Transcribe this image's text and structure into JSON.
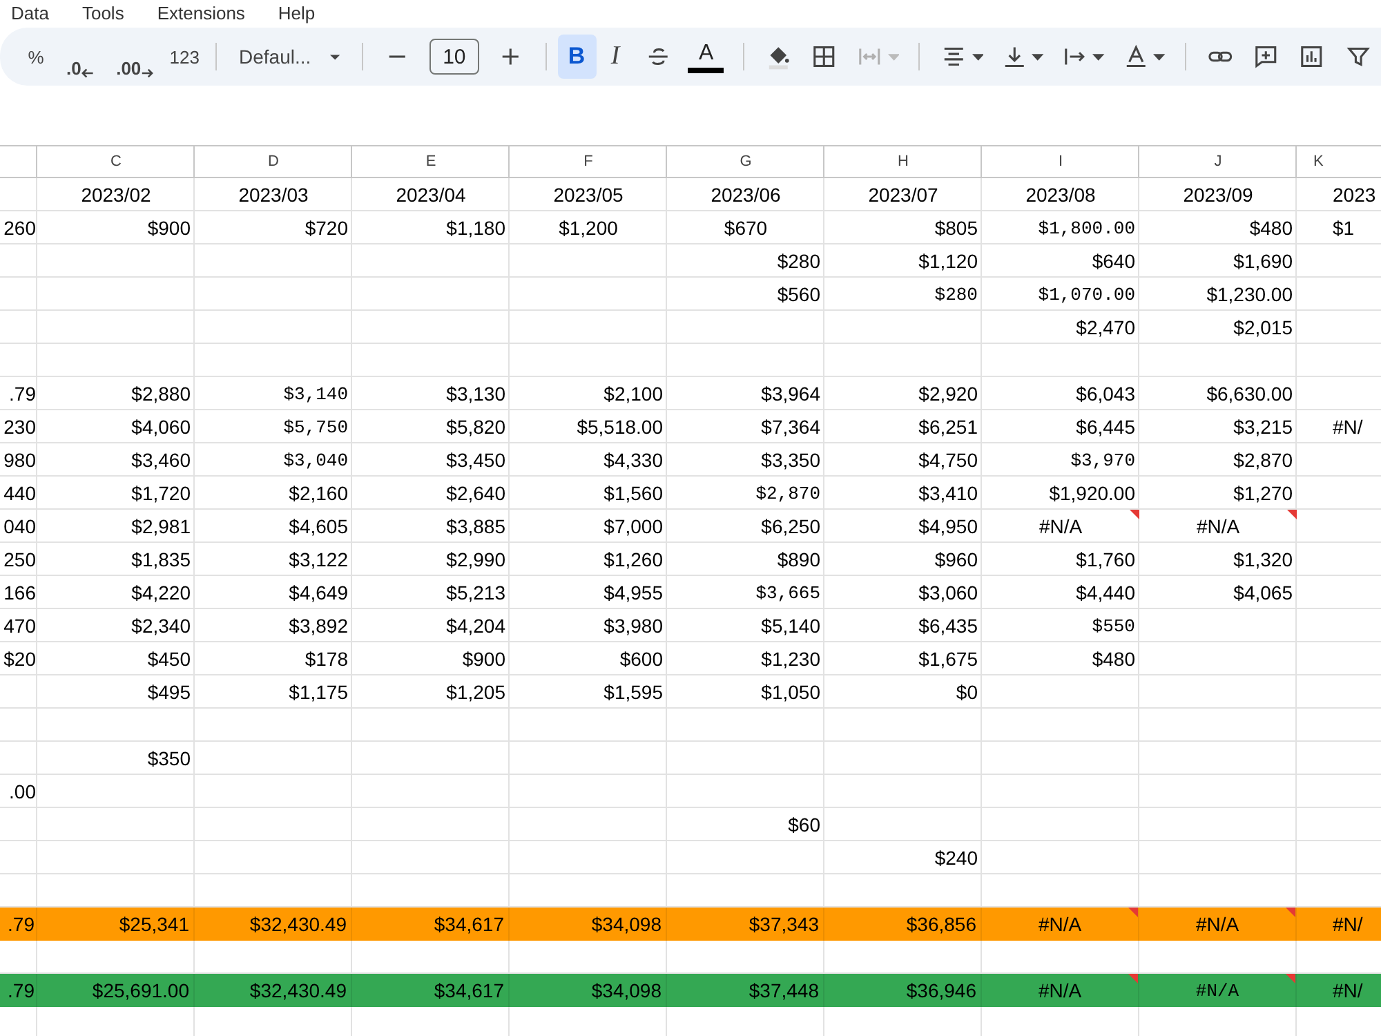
{
  "menu": [
    "Data",
    "Tools",
    "Extensions",
    "Help"
  ],
  "toolbar": {
    "percent": "%",
    "decrease_decimals": ".0",
    "increase_decimals": ".00",
    "number_format": "123",
    "font": "Defaul...",
    "font_size": "10",
    "bold": {
      "label": "B",
      "selected": true
    },
    "italic": "I",
    "text_color": "A",
    "merge_disabled": true
  },
  "columns": [
    "C",
    "D",
    "E",
    "F",
    "G",
    "H",
    "I",
    "J",
    "K"
  ],
  "rows": [
    {
      "cells": [
        null,
        {
          "text": "2023/02",
          "centered": true
        },
        {
          "text": "2023/03",
          "centered": true
        },
        {
          "text": "2023/04",
          "centered": true
        },
        {
          "text": "2023/05",
          "centered": true
        },
        {
          "text": "2023/06",
          "centered": true
        },
        {
          "text": "2023/07",
          "centered": true
        },
        {
          "text": "2023/08",
          "centered": true
        },
        {
          "text": "2023/09",
          "centered": true
        },
        "2023"
      ]
    },
    {
      "cells": [
        "260",
        "$900",
        "$720",
        "$1,180",
        {
          "text": "$1,200",
          "centered": true
        },
        {
          "text": "$670",
          "centered": true
        },
        "$805",
        {
          "text": "$1,800.00",
          "mono": true
        },
        "$480",
        "$1"
      ]
    },
    {
      "cells": [
        null,
        null,
        null,
        null,
        null,
        "$280",
        "$1,120",
        "$640",
        "$1,690",
        null
      ]
    },
    {
      "cells": [
        null,
        null,
        null,
        null,
        null,
        "$560",
        {
          "text": "$280",
          "mono": true
        },
        {
          "text": "$1,070.00",
          "mono": true
        },
        "$1,230.00",
        null
      ]
    },
    {
      "cells": [
        null,
        null,
        null,
        null,
        null,
        null,
        null,
        "$2,470",
        "$2,015",
        null
      ]
    },
    {
      "cells": [
        null,
        null,
        null,
        null,
        null,
        null,
        null,
        null,
        null,
        null
      ]
    },
    {
      "cells": [
        ".79",
        "$2,880",
        {
          "text": "$3,140",
          "mono": true
        },
        "$3,130",
        "$2,100",
        "$3,964",
        "$2,920",
        "$6,043",
        "$6,630.00",
        null
      ]
    },
    {
      "cells": [
        "230",
        "$4,060",
        {
          "text": "$5,750",
          "mono": true
        },
        "$5,820",
        "$5,518.00",
        "$7,364",
        "$6,251",
        "$6,445",
        "$3,215",
        "#N/"
      ]
    },
    {
      "cells": [
        "980",
        "$3,460",
        {
          "text": "$3,040",
          "mono": true
        },
        "$3,450",
        "$4,330",
        "$3,350",
        "$4,750",
        {
          "text": "$3,970",
          "mono": true
        },
        "$2,870",
        null
      ]
    },
    {
      "cells": [
        "440",
        "$1,720",
        "$2,160",
        "$2,640",
        "$1,560",
        {
          "text": "$2,870",
          "mono": true
        },
        "$3,410",
        "$1,920.00",
        "$1,270",
        null
      ]
    },
    {
      "cells": [
        "040",
        "$2,981",
        "$4,605",
        "$3,885",
        "$7,000",
        "$6,250",
        "$4,950",
        {
          "text": "#N/A",
          "centered": true,
          "flagged": true
        },
        {
          "text": "#N/A",
          "centered": true,
          "flagged": true
        },
        null
      ]
    },
    {
      "cells": [
        "250",
        "$1,835",
        "$3,122",
        "$2,990",
        "$1,260",
        "$890",
        "$960",
        "$1,760",
        "$1,320",
        null
      ]
    },
    {
      "cells": [
        "166",
        "$4,220",
        "$4,649",
        "$5,213",
        "$4,955",
        {
          "text": "$3,665",
          "mono": true
        },
        "$3,060",
        "$4,440",
        "$4,065",
        null
      ]
    },
    {
      "cells": [
        "470",
        "$2,340",
        "$3,892",
        "$4,204",
        "$3,980",
        "$5,140",
        "$6,435",
        {
          "text": "$550",
          "mono": true
        },
        null,
        null
      ]
    },
    {
      "cells": [
        "$20",
        "$450",
        "$178",
        "$900",
        "$600",
        "$1,230",
        "$1,675",
        "$480",
        null,
        null
      ]
    },
    {
      "cells": [
        null,
        "$495",
        "$1,175",
        "$1,205",
        "$1,595",
        "$1,050",
        "$0",
        null,
        null,
        null
      ]
    },
    {
      "cells": [
        null,
        null,
        null,
        null,
        null,
        null,
        null,
        null,
        null,
        null
      ]
    },
    {
      "cells": [
        null,
        "$350",
        null,
        null,
        null,
        null,
        null,
        null,
        null,
        null
      ]
    },
    {
      "cells": [
        ".00",
        null,
        null,
        null,
        null,
        null,
        null,
        null,
        null,
        null
      ]
    },
    {
      "cells": [
        null,
        null,
        null,
        null,
        null,
        "$60",
        null,
        null,
        null,
        null
      ]
    },
    {
      "cells": [
        null,
        null,
        null,
        null,
        null,
        null,
        "$240",
        null,
        null,
        null
      ]
    },
    {
      "cells": [
        null,
        null,
        null,
        null,
        null,
        null,
        null,
        null,
        null,
        null
      ]
    },
    {
      "color": "#ff9900",
      "cells": [
        ".79",
        "$25,341",
        "$32,430.49",
        "$34,617",
        "$34,098",
        "$37,343",
        "$36,856",
        {
          "text": "#N/A",
          "centered": true,
          "flagged": true
        },
        {
          "text": "#N/A",
          "centered": true,
          "flagged": true
        },
        "#N/"
      ]
    },
    {
      "cells": [
        null,
        null,
        null,
        null,
        null,
        null,
        null,
        null,
        null,
        null
      ]
    },
    {
      "color": "#34a853",
      "cells": [
        ".79",
        "$25,691.00",
        "$32,430.49",
        "$34,617",
        "$34,098",
        "$37,448",
        "$36,946",
        {
          "text": "#N/A",
          "centered": true,
          "flagged": true
        },
        {
          "text": "#N/A",
          "centered": true,
          "mono": true,
          "flagged": true
        },
        "#N/"
      ]
    },
    {
      "cells": [
        null,
        null,
        null,
        null,
        null,
        null,
        null,
        null,
        null,
        null
      ]
    }
  ]
}
